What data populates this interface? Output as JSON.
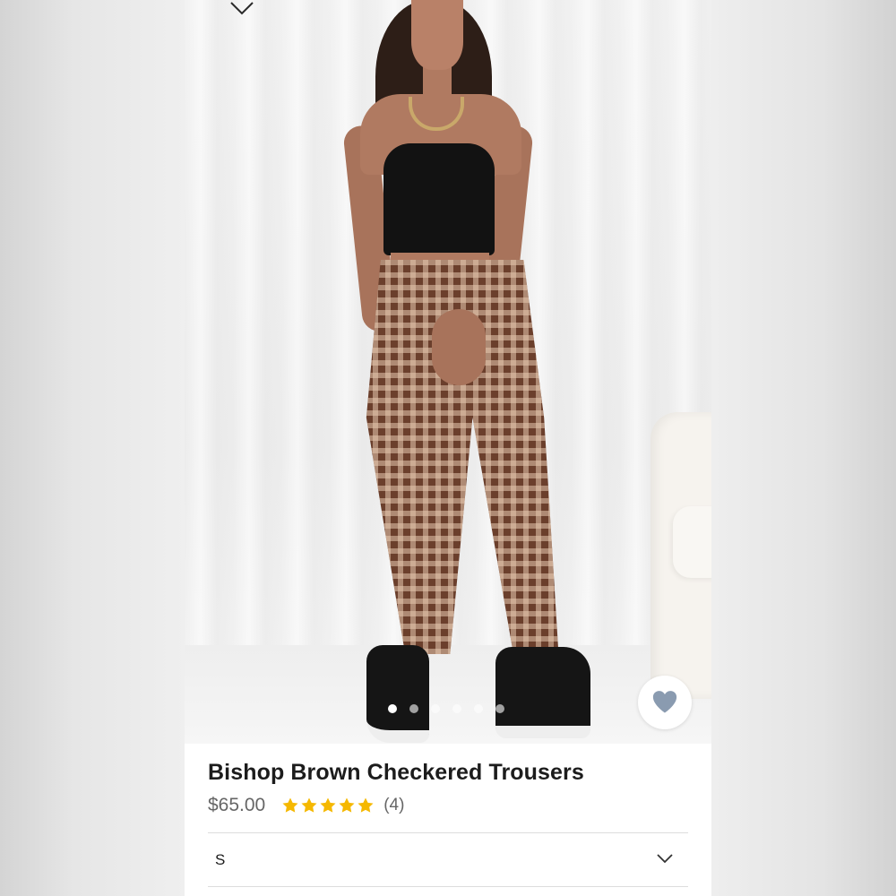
{
  "product": {
    "title": "Bishop Brown Checkered Trousers",
    "price": "$65.00",
    "rating": 5,
    "rating_max": 5,
    "review_count": "(4)",
    "favorited": false
  },
  "gallery": {
    "image_count": 6,
    "active_index": 0
  },
  "size_select": {
    "selected": "S"
  },
  "icons": {
    "collapse": "chevron-down-icon",
    "favorite": "heart-icon",
    "star": "star-icon",
    "dropdown": "chevron-down-icon"
  },
  "colors": {
    "star": "#F5B800",
    "heart": "#8A9BB0",
    "title": "#1C1C1C",
    "price": "#666666"
  }
}
